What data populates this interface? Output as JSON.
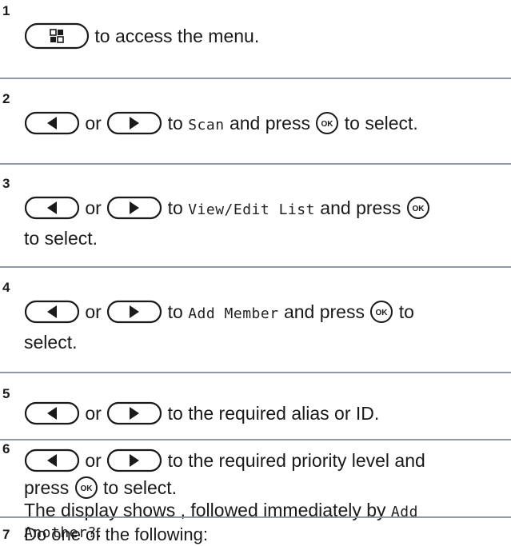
{
  "steps": [
    {
      "number": "1",
      "text_after_menu": " to access the menu."
    },
    {
      "number": "2",
      "or": " or ",
      "to": " to ",
      "target": "Scan",
      "and_press": " and press ",
      "to_select": " to select."
    },
    {
      "number": "3",
      "or": " or ",
      "to": " to ",
      "target": "View/Edit List",
      "and_press": " and press ",
      "line2": "to select."
    },
    {
      "number": "4",
      "or": " or ",
      "to": " to ",
      "target": "Add Member",
      "and_press": " and press ",
      "to_word": " to",
      "line2": "select."
    },
    {
      "number": "5",
      "or": " or ",
      "text": " to the required alias or ID."
    },
    {
      "number": "6",
      "or": " or ",
      "text": " to the required priority level and",
      "press": "press ",
      "to_select": " to select.",
      "display_text": "The display shows , followed immediately by ",
      "display_mono_1": "Add",
      "display_mono_2": "Another?",
      "display_end": "."
    },
    {
      "number": "7",
      "text": "Do one of the following:"
    }
  ],
  "icons": {
    "menu": "menu-button-icon",
    "left": "left-arrow-button-icon",
    "right": "right-arrow-button-icon",
    "ok": "ok-button-icon"
  },
  "colors": {
    "divider": "#8f9bac",
    "text": "#1a1a1a"
  },
  "ok_label": "OK"
}
